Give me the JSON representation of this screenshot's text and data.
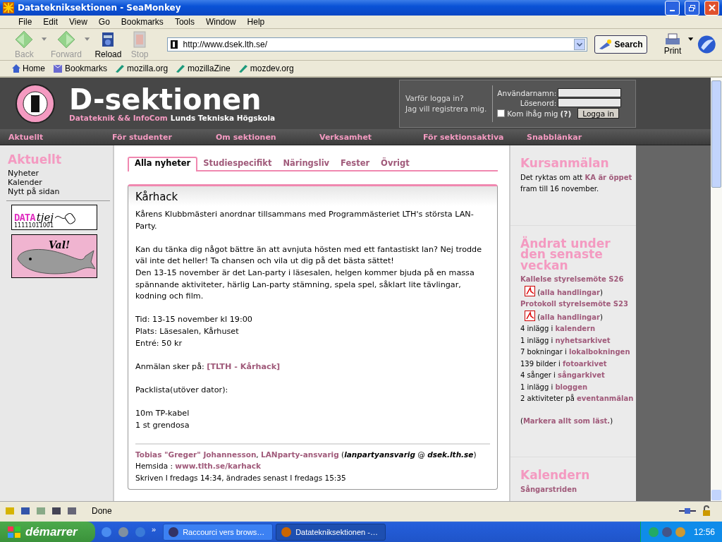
{
  "window": {
    "title": "Datatekniksektionen - SeaMonkey"
  },
  "menu": [
    "File",
    "Edit",
    "View",
    "Go",
    "Bookmarks",
    "Tools",
    "Window",
    "Help"
  ],
  "toolbar": [
    {
      "kind": "back",
      "label": "Back",
      "disabled": true
    },
    {
      "kind": "forward",
      "label": "Forward",
      "disabled": true
    },
    {
      "kind": "reload",
      "label": "Reload",
      "disabled": false
    },
    {
      "kind": "stop",
      "label": "Stop",
      "disabled": true
    }
  ],
  "address": {
    "value": "http://www.dsek.lth.se/"
  },
  "search_button": "Search",
  "print_button": "Print",
  "bookmarks": [
    {
      "kind": "home",
      "label": "Home"
    },
    {
      "kind": "bookmarks",
      "label": "Bookmarks"
    },
    {
      "kind": "site",
      "label": "mozilla.org"
    },
    {
      "kind": "site",
      "label": "mozillaZine"
    },
    {
      "kind": "site",
      "label": "mozdev.org"
    }
  ],
  "site": {
    "title": "D-sektionen",
    "subtitle_highlight": "Datateknik && InfoCom",
    "subtitle": "Lunds Tekniska Högskola",
    "login": {
      "links": [
        "Varför logga in?",
        "Jag vill registrera mig."
      ],
      "username_label": "Användarnamn:",
      "password_label": "Lösenord:",
      "remember_label": "Kom ihåg mig",
      "remember_checked": false,
      "help": "(?)",
      "button": "Logga in"
    },
    "nav": [
      "Aktuellt",
      "För studenter",
      "Om sektionen",
      "Verksamhet",
      "För sektionsaktiva",
      "Snabblänkar"
    ]
  },
  "sidebar": {
    "heading": "Aktuellt",
    "items": [
      "Nyheter",
      "Kalender",
      "Nytt på sidan"
    ],
    "banners": [
      {
        "kind": "datatjej",
        "text": "DATA",
        "script": "tjej",
        "digits": "11111011001"
      },
      {
        "kind": "whale",
        "text": "Val!"
      }
    ]
  },
  "tabs": [
    {
      "label": "Alla nyheter",
      "selected": true
    },
    {
      "label": "Studiespecifikt",
      "selected": false
    },
    {
      "label": "Näringsliv",
      "selected": false
    },
    {
      "label": "Fester",
      "selected": false
    },
    {
      "label": "Övrigt",
      "selected": false
    }
  ],
  "article": {
    "title": "Kårhack",
    "paragraphs": [
      [
        [
          {
            "kind": "text",
            "text": "Kårens Klubbmästeri anordnar tillsammans med Programmästeriet LTH's största LAN-Party."
          }
        ]
      ],
      [
        [
          {
            "kind": "text",
            "text": "Kan du tänka dig något bättre än att avnjuta hösten med ett fantastiskt lan? Nej trodde väl inte det heller! Ta chansen och vila ut dig på det bästa sättet!"
          }
        ],
        [
          {
            "kind": "text",
            "text": "Den 13-15 november är det Lan-party i läsesalen, helgen kommer bjuda på en massa spännande aktiviteter, härlig Lan-party stämning, spela spel, såklart lite tävlingar, kodning och film."
          }
        ]
      ],
      [
        [
          {
            "kind": "text",
            "text": "Tid: 13-15 november kl 19:00"
          }
        ],
        [
          {
            "kind": "text",
            "text": "Plats: Läsesalen, Kårhuset"
          }
        ],
        [
          {
            "kind": "text",
            "text": "Entré: 50 kr"
          }
        ]
      ],
      [
        [
          {
            "kind": "text",
            "text": "Anmälan sker på: "
          },
          {
            "kind": "link",
            "text": "[TLTH - Kårhack]"
          }
        ]
      ],
      [
        [
          {
            "kind": "text",
            "text": "Packlista(utöver dator):"
          }
        ]
      ],
      [
        [
          {
            "kind": "text",
            "text": "10m TP-kabel"
          }
        ],
        [
          {
            "kind": "text",
            "text": "1 st grendosa"
          }
        ]
      ]
    ],
    "footer": [
      [
        {
          "kind": "link",
          "text": "Tobias \"Greger\" Johannesson"
        },
        {
          "kind": "text",
          "text": ", "
        },
        {
          "kind": "link",
          "text": "LANparty-ansvarig"
        },
        {
          "kind": "text",
          "text": " ("
        },
        {
          "kind": "emphasis",
          "text": "lanpartyansvarig"
        },
        {
          "kind": "text",
          "text": " @ "
        },
        {
          "kind": "emphasis",
          "text": "dsek.lth.se"
        },
        {
          "kind": "text",
          "text": ")"
        }
      ],
      [
        {
          "kind": "text",
          "text": "Hemsida : "
        },
        {
          "kind": "link",
          "text": "www.tlth.se/karhack"
        }
      ],
      [
        {
          "kind": "text",
          "text": "Skriven I fredags 14:34, ändrades senast I fredags 15:35"
        }
      ]
    ]
  },
  "right": [
    {
      "heading": "Kursanmälan",
      "paragraphs": [
        [
          {
            "kind": "text",
            "text": "Det ryktas om att "
          },
          {
            "kind": "link",
            "text": "KA är öppet"
          },
          {
            "kind": "text",
            "text": " fram till 16 november."
          }
        ]
      ]
    },
    {
      "heading": "Ändrat under den senaste veckan",
      "paragraphs": [
        [
          {
            "kind": "link",
            "text": "Kallelse styrelsemöte S26"
          },
          {
            "kind": "pdf"
          },
          {
            "kind": "text",
            "text": " ("
          },
          {
            "kind": "link",
            "text": "alla handlingar"
          },
          {
            "kind": "text",
            "text": ")"
          }
        ],
        [
          {
            "kind": "link",
            "text": "Protokoll styrelsemöte S23"
          },
          {
            "kind": "pdf"
          },
          {
            "kind": "text",
            "text": " ("
          },
          {
            "kind": "link",
            "text": "alla handlingar"
          },
          {
            "kind": "text",
            "text": ")"
          }
        ],
        [
          {
            "kind": "text",
            "text": "4 inlägg i "
          },
          {
            "kind": "link",
            "text": "kalendern"
          }
        ],
        [
          {
            "kind": "text",
            "text": "1 inlägg i "
          },
          {
            "kind": "link",
            "text": "nyhetsarkivet"
          }
        ],
        [
          {
            "kind": "text",
            "text": "7 bokningar i "
          },
          {
            "kind": "link",
            "text": "lokalbokningen"
          }
        ],
        [
          {
            "kind": "text",
            "text": "139 bilder i "
          },
          {
            "kind": "link",
            "text": "fotoarkivet"
          }
        ],
        [
          {
            "kind": "text",
            "text": "4 sånger i "
          },
          {
            "kind": "link",
            "text": "sångarkivet"
          }
        ],
        [
          {
            "kind": "text",
            "text": "1 inlägg i "
          },
          {
            "kind": "link",
            "text": "bloggen"
          }
        ],
        [
          {
            "kind": "text",
            "text": "2 aktiviteter på "
          },
          {
            "kind": "link",
            "text": "eventanmälan"
          }
        ],
        [
          {
            "kind": "text",
            "text": "("
          },
          {
            "kind": "link",
            "text": "Markera allt som läst."
          },
          {
            "kind": "text",
            "text": ")"
          }
        ]
      ]
    },
    {
      "heading": "Kalendern",
      "paragraphs": [
        [
          {
            "kind": "link",
            "text": "Sångarstriden"
          }
        ]
      ]
    }
  ],
  "status_bar": {
    "text": "Done"
  },
  "taskbar": {
    "start": "démarrer",
    "more": "»",
    "tasks": [
      {
        "label": "Raccourci vers brows…",
        "selected": false
      },
      {
        "label": "Datatekniksektionen -…",
        "selected": true
      }
    ],
    "clock": "12:56"
  }
}
